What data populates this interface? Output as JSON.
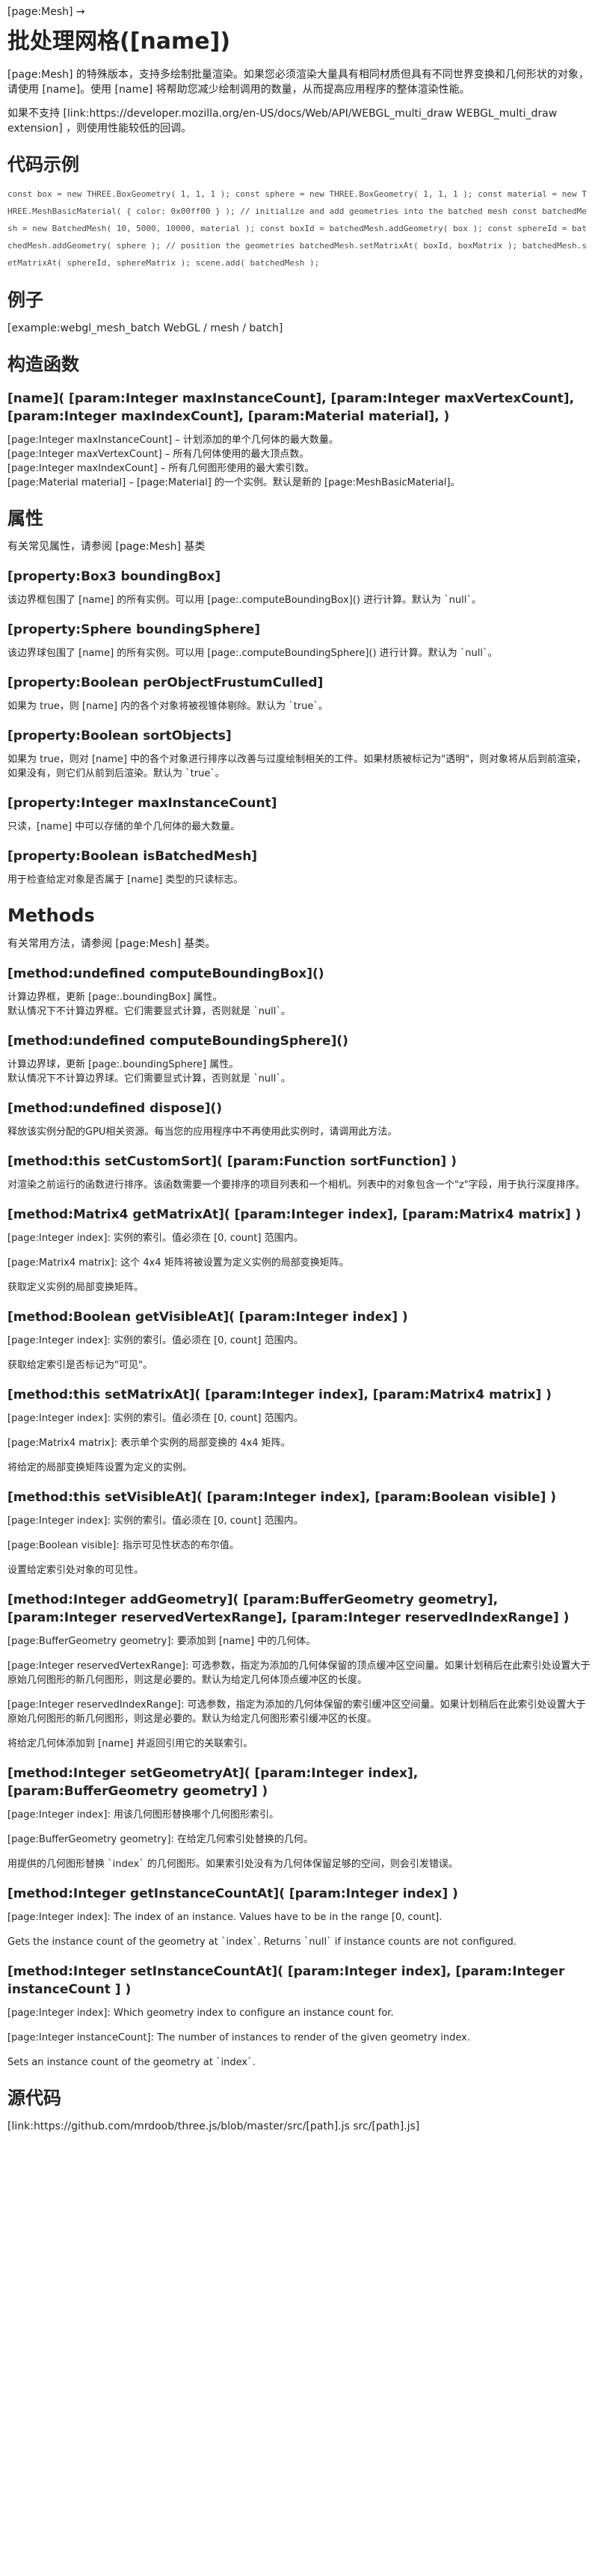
{
  "breadcrumb": "[page:Mesh] →",
  "title": "批处理网格([name])",
  "intro": [
    "[page:Mesh] 的特殊版本，支持多绘制批量渲染。如果您必须渲染大量具有相同材质但具有不同世界变换和几何形状的对象，请使用 [name]。使用 [name] 将帮助您减少绘制调用的数量，从而提高应用程序的整体渲染性能。",
    "如果不支持 [link:https://developer.mozilla.org/en-US/docs/Web/API/WEBGL_multi_draw WEBGL_multi_draw extension] ，则使用性能较低的回调。"
  ],
  "code_heading": "代码示例",
  "code": "const box = new THREE.BoxGeometry( 1, 1, 1 ); const sphere = new THREE.BoxGeometry( 1, 1, 1 ); const material = new THREE.MeshBasicMaterial( { color: 0x00ff00 } ); // initialize and add geometries into the batched mesh const batchedMesh = new BatchedMesh( 10, 5000, 10000, material ); const boxId = batchedMesh.addGeometry( box ); const sphereId = batchedMesh.addGeometry( sphere ); // position the geometries batchedMesh.setMatrixAt( boxId, boxMatrix ); batchedMesh.setMatrixAt( sphereId, sphereMatrix ); scene.add( batchedMesh );",
  "example_heading": "例子",
  "example": "[example:webgl_mesh_batch WebGL / mesh / batch]",
  "constructor_heading": "构造函数",
  "constructor_sig": "[name]( [param:Integer maxInstanceCount], [param:Integer maxVertexCount], [param:Integer maxIndexCount], [param:Material material], )",
  "constructor_params": [
    "[page:Integer maxInstanceCount] – 计划添加的单个几何体的最大数量。",
    "[page:Integer maxVertexCount] – 所有几何体使用的最大顶点数。",
    "[page:Integer maxIndexCount] – 所有几何图形使用的最大索引数。",
    "[page:Material material] – [page:Material] 的一个实例。默认是新的 [page:MeshBasicMaterial]。"
  ],
  "properties_heading": "属性",
  "properties_intro": "有关常见属性，请参阅 [page:Mesh] 基类",
  "properties": [
    {
      "title": "[property:Box3 boundingBox]",
      "desc": [
        "该边界框包围了 [name] 的所有实例。可以用 [page:.computeBoundingBox]() 进行计算。默认为 `null`。"
      ]
    },
    {
      "title": "[property:Sphere boundingSphere]",
      "desc": [
        "该边界球包围了 [name] 的所有实例。可以用 [page:.computeBoundingSphere]() 进行计算。默认为 `null`。"
      ]
    },
    {
      "title": "[property:Boolean perObjectFrustumCulled]",
      "desc": [
        "如果为 true，则 [name] 内的各个对象将被视锥体剔除。默认为 `true`。"
      ]
    },
    {
      "title": "[property:Boolean sortObjects]",
      "desc": [
        "如果为 true，则对 [name] 中的各个对象进行排序以改善与过度绘制相关的工件。如果材质被标记为\"透明\"，则对象将从后到前渲染，如果没有，则它们从前到后渲染。默认为 `true`。"
      ]
    },
    {
      "title": "[property:Integer maxInstanceCount]",
      "desc": [
        "只读，[name] 中可以存储的单个几何体的最大数量。"
      ]
    },
    {
      "title": "[property:Boolean isBatchedMesh]",
      "desc": [
        "用于检查给定对象是否属于 [name] 类型的只读标志。"
      ]
    }
  ],
  "methods_heading": "Methods",
  "methods_intro": "有关常用方法，请参阅 [page:Mesh] 基类。",
  "methods": [
    {
      "title": "[method:undefined computeBoundingBox]()",
      "desc": [
        "计算边界框，更新 [page:.boundingBox] 属性。",
        "默认情况下不计算边界框。它们需要显式计算，否则就是 `null`。"
      ]
    },
    {
      "title": "[method:undefined computeBoundingSphere]()",
      "desc": [
        "计算边界球，更新 [page:.boundingSphere] 属性。",
        "默认情况下不计算边界球。它们需要显式计算，否则就是 `null`。"
      ]
    },
    {
      "title": "[method:undefined dispose]()",
      "desc": [
        "释放该实例分配的GPU相关资源。每当您的应用程序中不再使用此实例时，请调用此方法。"
      ]
    },
    {
      "title": "[method:this setCustomSort]( [param:Function sortFunction] )",
      "desc": [
        "对渲染之前运行的函数进行排序。该函数需要一个要排序的项目列表和一个相机。列表中的对象包含一个\"z\"字段，用于执行深度排序。"
      ]
    },
    {
      "title": "[method:Matrix4 getMatrixAt]( [param:Integer index], [param:Matrix4 matrix] )",
      "desc": [
        "[page:Integer index]: 实例的索引。值必须在 [0, count] 范围内。",
        "",
        "[page:Matrix4 matrix]: 这个 4x4 矩阵将被设置为定义实例的局部变换矩阵。",
        "",
        "获取定义实例的局部变换矩阵。"
      ]
    },
    {
      "title": "[method:Boolean getVisibleAt]( [param:Integer index] )",
      "desc": [
        "[page:Integer index]: 实例的索引。值必须在 [0, count] 范围内。",
        "",
        "获取给定索引是否标记为\"可见\"。"
      ]
    },
    {
      "title": "[method:this setMatrixAt]( [param:Integer index], [param:Matrix4 matrix] )",
      "desc": [
        "[page:Integer index]: 实例的索引。值必须在 [0, count] 范围内。",
        "",
        "[page:Matrix4 matrix]: 表示单个实例的局部变换的 4x4 矩阵。",
        "",
        "将给定的局部变换矩阵设置为定义的实例。"
      ]
    },
    {
      "title": "[method:this setVisibleAt]( [param:Integer index], [param:Boolean visible] )",
      "desc": [
        "[page:Integer index]: 实例的索引。值必须在 [0, count] 范围内。",
        "",
        "[page:Boolean visible]: 指示可见性状态的布尔值。",
        "",
        "设置给定索引处对象的可见性。"
      ]
    },
    {
      "title": "[method:Integer addGeometry]( [param:BufferGeometry geometry], [param:Integer reservedVertexRange], [param:Integer reservedIndexRange] )",
      "desc": [
        "[page:BufferGeometry geometry]: 要添加到 [name] 中的几何体。",
        "",
        "[page:Integer reservedVertexRange]: 可选参数，指定为添加的几何体保留的顶点缓冲区空间量。如果计划稍后在此索引处设置大于原始几何图形的新几何图形，则这是必要的。默认为给定几何体顶点缓冲区的长度。",
        "",
        "[page:Integer reservedIndexRange]: 可选参数，指定为添加的几何体保留的索引缓冲区空间量。如果计划稍后在此索引处设置大于原始几何图形的新几何图形，则这是必要的。默认为给定几何图形索引缓冲区的长度。",
        "",
        "将给定几何体添加到 [name] 并返回引用它的关联索引。"
      ]
    },
    {
      "title": "[method:Integer setGeometryAt]( [param:Integer index], [param:BufferGeometry geometry] )",
      "desc": [
        "[page:Integer index]: 用该几何图形替换哪个几何图形索引。",
        "",
        "[page:BufferGeometry geometry]: 在给定几何索引处替换的几何。",
        "",
        "用提供的几何图形替换 `index` 的几何图形。如果索引处没有为几何体保留足够的空间，则会引发错误。"
      ]
    },
    {
      "title": "[method:Integer getInstanceCountAt]( [param:Integer index] )",
      "desc": [
        "[page:Integer index]: The index of an instance. Values have to be in the range [0, count].",
        "",
        "Gets the instance count of the geometry at `index`. Returns `null` if instance counts are not configured."
      ]
    },
    {
      "title": "[method:Integer setInstanceCountAt]( [param:Integer index], [param:Integer instanceCount ] )",
      "desc": [
        "[page:Integer index]: Which geometry index to configure an instance count for.",
        "",
        "[page:Integer instanceCount]: The number of instances to render of the given geometry index.",
        "",
        "Sets an instance count of the geometry at `index`."
      ]
    }
  ],
  "source_heading": "源代码",
  "source_link": "[link:https://github.com/mrdoob/three.js/blob/master/src/[path].js src/[path].js]"
}
